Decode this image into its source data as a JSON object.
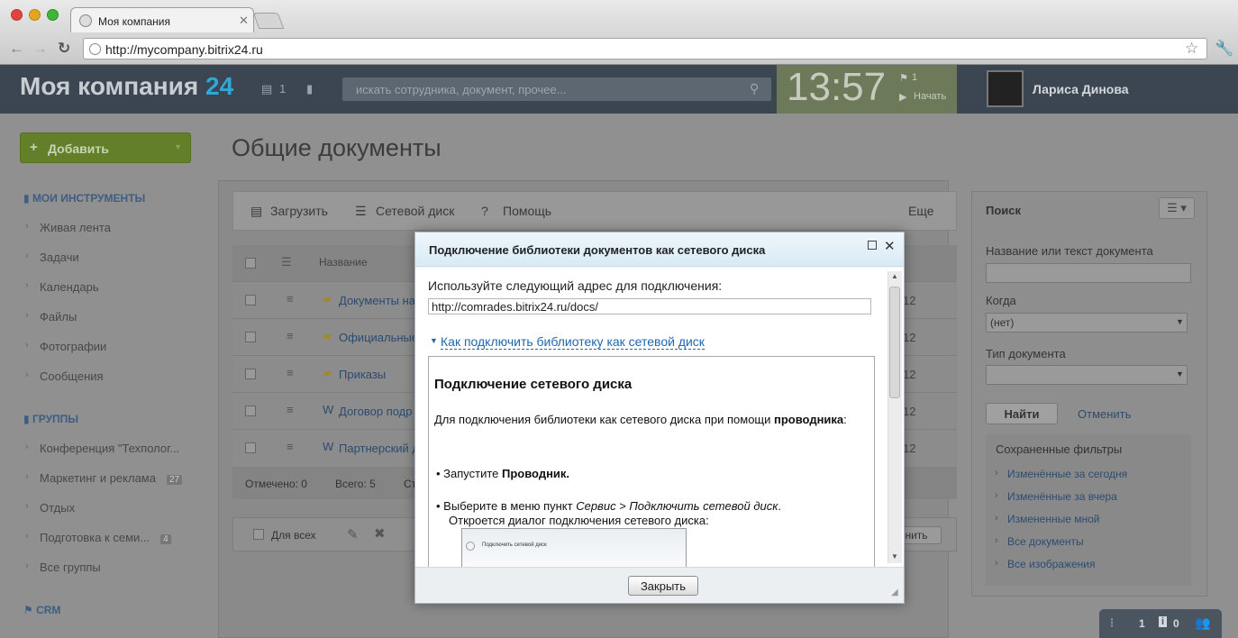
{
  "browser": {
    "tab_title": "Моя компания",
    "url": "http://mycompany.bitrix24.ru"
  },
  "header": {
    "logo_main": "Моя компания",
    "logo_accent": "24",
    "messages_count": "1",
    "search_placeholder": "искать сотрудника, документ, прочее...",
    "clock": "13:57",
    "tasks_count": "1",
    "start_label": "Начать",
    "user_name": "Лариса Динова"
  },
  "sidebar": {
    "add_label": "Добавить",
    "tools_title": "МОИ ИНСТРУМЕНТЫ",
    "tools": [
      "Живая лента",
      "Задачи",
      "Календарь",
      "Файлы",
      "Фотографии",
      "Сообщения"
    ],
    "groups_title": "ГРУППЫ",
    "groups": [
      {
        "label": "Конференция \"Техполог...",
        "badge": ""
      },
      {
        "label": "Маркетинг и реклама",
        "badge": "27"
      },
      {
        "label": "Отдых",
        "badge": ""
      },
      {
        "label": "Подготовка к семи...",
        "badge": "4"
      },
      {
        "label": "Все группы",
        "badge": ""
      }
    ],
    "crm_title": "CRM"
  },
  "main": {
    "page_title": "Общие документы",
    "toolbar": {
      "upload": "Загрузить",
      "network_disk": "Сетевой диск",
      "help": "Помощь",
      "more": "Еще"
    },
    "column_name": "Название",
    "rows": [
      {
        "name": "Документы на",
        "date": "12"
      },
      {
        "name": "Официальные",
        "date": "12"
      },
      {
        "name": "Приказы",
        "date": "12"
      },
      {
        "name": "Договор подр",
        "date": "12"
      },
      {
        "name": "Партнерский д",
        "date": "12"
      }
    ],
    "footer": {
      "selected": "Отмечено: 0",
      "total": "Всего: 5",
      "pages": "Ст"
    },
    "action_for_all": "Для всех",
    "apply_partial": "нить"
  },
  "right_panel": {
    "title": "Поиск",
    "name_label": "Название или текст документа",
    "when_label": "Когда",
    "when_value": "(нет)",
    "type_label": "Тип документа",
    "find_button": "Найти",
    "cancel_link": "Отменить",
    "saved_filters_title": "Сохраненные фильтры",
    "filters": [
      "Изменённые за сегодня",
      "Изменённые за вчера",
      "Измененные мной",
      "Все документы",
      "Все изображения"
    ]
  },
  "bottom_bar": {
    "count_a": "1",
    "count_b": "0"
  },
  "dialog": {
    "title": "Подключение библиотеки документов как сетевого диска",
    "use_address_label": "Используйте следующий адрес для подключения:",
    "address": "http://comrades.bitrix24.ru/docs/",
    "how_link": "Как подключить библиотеку как сетевой диск",
    "doc_heading": "Подключение сетевого диска",
    "doc_para1": "Для подключения библиотеки как сетевого диска при помощи ",
    "doc_para1_bold": "проводника",
    "doc_para1_end": ":",
    "bullet1_a": "Запустите ",
    "bullet1_b": "Проводник.",
    "bullet2_a": "Выберите в меню пункт ",
    "bullet2_b": "Сервис > Подключить сетевой диск",
    "bullet2_c": ".",
    "bullet2_line2": "Откроется диалог подключения сетевого диска:",
    "screenshot_title": "Подключить сетевой диск",
    "close_button": "Закрыть"
  }
}
